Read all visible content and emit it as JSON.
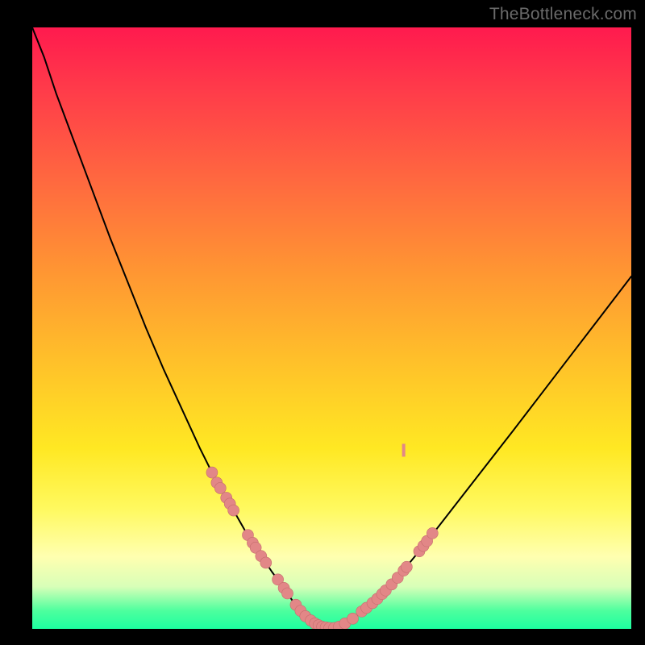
{
  "watermark": "TheBottleneck.com",
  "chart_data": {
    "type": "line",
    "title": "",
    "xlabel": "",
    "ylabel": "",
    "xlim": [
      0,
      100
    ],
    "ylim": [
      0,
      100
    ],
    "grid": false,
    "legend": false,
    "series": [
      {
        "name": "bottleneck-curve",
        "x": [
          0,
          2,
          4,
          7,
          10,
          13,
          16,
          19,
          22,
          25,
          28,
          30,
          32,
          34,
          36,
          38,
          40,
          42,
          43.5,
          45,
          47,
          50,
          53,
          56,
          60,
          65,
          70,
          75,
          80,
          85,
          90,
          95,
          100
        ],
        "y": [
          100,
          95,
          89,
          81,
          73,
          65,
          57.5,
          50,
          43,
          36.5,
          30,
          26,
          22.5,
          19,
          15.5,
          12.5,
          9.5,
          6.8,
          4.6,
          2.8,
          1.1,
          0.1,
          1.3,
          3.6,
          7.4,
          13.4,
          19.8,
          26.2,
          32.6,
          39.1,
          45.6,
          52.1,
          58.6
        ]
      }
    ],
    "scatter_points": {
      "name": "sample-markers",
      "points": [
        {
          "x": 30.0,
          "y": 26.0
        },
        {
          "x": 30.8,
          "y": 24.3
        },
        {
          "x": 31.4,
          "y": 23.4
        },
        {
          "x": 32.4,
          "y": 21.8
        },
        {
          "x": 33.0,
          "y": 20.8
        },
        {
          "x": 33.6,
          "y": 19.7
        },
        {
          "x": 36.0,
          "y": 15.6
        },
        {
          "x": 36.8,
          "y": 14.3
        },
        {
          "x": 37.3,
          "y": 13.5
        },
        {
          "x": 38.2,
          "y": 12.1
        },
        {
          "x": 39.0,
          "y": 11.0
        },
        {
          "x": 41.0,
          "y": 8.2
        },
        {
          "x": 42.0,
          "y": 6.8
        },
        {
          "x": 42.6,
          "y": 5.9
        },
        {
          "x": 44.0,
          "y": 4.0
        },
        {
          "x": 44.8,
          "y": 3.0
        },
        {
          "x": 45.6,
          "y": 2.1
        },
        {
          "x": 46.5,
          "y": 1.4
        },
        {
          "x": 47.2,
          "y": 0.9
        },
        {
          "x": 47.8,
          "y": 0.6
        },
        {
          "x": 48.4,
          "y": 0.35
        },
        {
          "x": 49.0,
          "y": 0.25
        },
        {
          "x": 49.6,
          "y": 0.15
        },
        {
          "x": 50.4,
          "y": 0.15
        },
        {
          "x": 51.2,
          "y": 0.35
        },
        {
          "x": 52.2,
          "y": 0.9
        },
        {
          "x": 53.5,
          "y": 1.7
        },
        {
          "x": 55.0,
          "y": 2.9
        },
        {
          "x": 55.8,
          "y": 3.5
        },
        {
          "x": 56.8,
          "y": 4.3
        },
        {
          "x": 57.6,
          "y": 5.0
        },
        {
          "x": 58.4,
          "y": 5.8
        },
        {
          "x": 59.0,
          "y": 6.4
        },
        {
          "x": 60.0,
          "y": 7.4
        },
        {
          "x": 61.0,
          "y": 8.5
        },
        {
          "x": 62.0,
          "y": 9.7
        },
        {
          "x": 62.5,
          "y": 10.3
        },
        {
          "x": 64.6,
          "y": 12.9
        },
        {
          "x": 65.3,
          "y": 13.8
        },
        {
          "x": 65.9,
          "y": 14.6
        },
        {
          "x": 66.8,
          "y": 15.9
        }
      ]
    },
    "anomaly_mark": {
      "x": 62.0,
      "y": 29.7
    },
    "colors": {
      "curve": "#000000",
      "dot_fill": "#e28787",
      "dot_stroke": "#c56d6d"
    }
  }
}
